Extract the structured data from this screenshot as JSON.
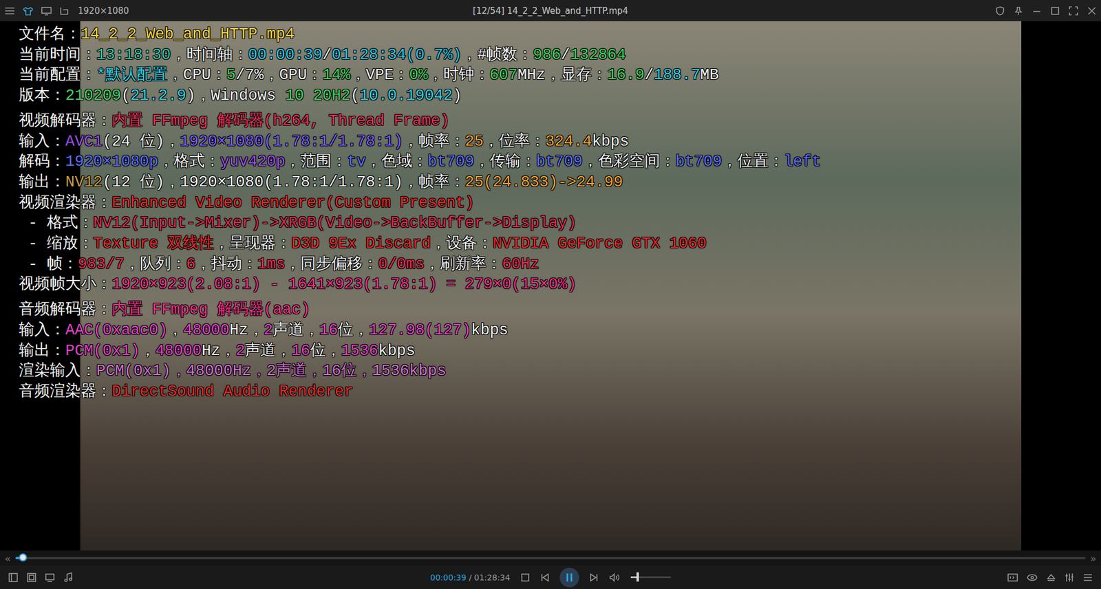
{
  "window": {
    "resolution": "1920×1080",
    "title": "[12/54] 14_2_2_Web_and_HTTP.mp4"
  },
  "osd": {
    "groups": [
      {
        "lines": [
          {
            "segments": [
              {
                "text": "文件名：",
                "color": "#f2f2f2"
              },
              {
                "text": "14_2_2_Web_and_HTTP.mp4",
                "color": "#f2d43a"
              }
            ]
          },
          {
            "segments": [
              {
                "text": "当前时间：",
                "color": "#f2f2f2"
              },
              {
                "text": "13:18:30",
                "color": "#38c0a8"
              },
              {
                "text": "，时间轴：",
                "color": "#f2f2f2"
              },
              {
                "text": "00:00:39",
                "color": "#2cc4e6"
              },
              {
                "text": "/",
                "color": "#f2f2f2"
              },
              {
                "text": "01:28:34",
                "color": "#2cc4e6"
              },
              {
                "text": "(0.7%)",
                "color": "#2cc4e6"
              },
              {
                "text": "，#帧数：",
                "color": "#f2f2f2"
              },
              {
                "text": "986",
                "color": "#3ed35a"
              },
              {
                "text": "/",
                "color": "#f2f2f2"
              },
              {
                "text": "132864",
                "color": "#3ed35a"
              }
            ]
          },
          {
            "segments": [
              {
                "text": "当前配置：",
                "color": "#f2f2f2"
              },
              {
                "text": "*默认配置",
                "color": "#2ed0e6"
              },
              {
                "text": "，CPU：",
                "color": "#f2f2f2"
              },
              {
                "text": "5",
                "color": "#3ed35a"
              },
              {
                "text": "/7%",
                "color": "#f2f2f2"
              },
              {
                "text": "，GPU：",
                "color": "#f2f2f2"
              },
              {
                "text": "14%",
                "color": "#3ed35a"
              },
              {
                "text": "，VPE：",
                "color": "#f2f2f2"
              },
              {
                "text": "0%",
                "color": "#3ed35a"
              },
              {
                "text": "，时钟：",
                "color": "#f2f2f2"
              },
              {
                "text": "607",
                "color": "#3ed35a"
              },
              {
                "text": "MHz，显存：",
                "color": "#f2f2f2"
              },
              {
                "text": "16.9",
                "color": "#3ed35a"
              },
              {
                "text": "/",
                "color": "#f2f2f2"
              },
              {
                "text": "188.7",
                "color": "#2ed0e6"
              },
              {
                "text": "MB",
                "color": "#f2f2f2"
              }
            ]
          },
          {
            "segments": [
              {
                "text": "版本：",
                "color": "#f2f2f2"
              },
              {
                "text": "210209",
                "color": "#3ed35a"
              },
              {
                "text": "(",
                "color": "#f2f2f2"
              },
              {
                "text": "21.2.9",
                "color": "#2ed0e6"
              },
              {
                "text": ")，Windows ",
                "color": "#f2f2f2"
              },
              {
                "text": "10 20H2",
                "color": "#3ed35a"
              },
              {
                "text": "(",
                "color": "#f2f2f2"
              },
              {
                "text": "10.0.19042",
                "color": "#2ed0e6"
              },
              {
                "text": ")",
                "color": "#f2f2f2"
              }
            ]
          }
        ]
      },
      {
        "lines": [
          {
            "segments": [
              {
                "text": "视频解码器：",
                "color": "#f2f2f2"
              },
              {
                "text": "内置 FFmpeg 解码器(h264, Thread Frame)",
                "color": "#e8305a"
              }
            ]
          },
          {
            "segments": [
              {
                "text": "输入：",
                "color": "#f2f2f2"
              },
              {
                "text": "AVC1",
                "color": "#9a4de6"
              },
              {
                "text": "(24 位)，",
                "color": "#f2f2f2"
              },
              {
                "text": "1920×1080(1.78:1/1.78:1)",
                "color": "#7a5cff"
              },
              {
                "text": "，帧率：",
                "color": "#f2f2f2"
              },
              {
                "text": "25",
                "color": "#f0a030"
              },
              {
                "text": "，位率：",
                "color": "#f2f2f2"
              },
              {
                "text": "324.4",
                "color": "#f0a030"
              },
              {
                "text": "kbps",
                "color": "#f2f2f2"
              }
            ]
          },
          {
            "segments": [
              {
                "text": "解码：",
                "color": "#f2f2f2"
              },
              {
                "text": "1920×1080p",
                "color": "#5a6cff"
              },
              {
                "text": "，格式：",
                "color": "#f2f2f2"
              },
              {
                "text": "yuv420p",
                "color": "#9a4de6"
              },
              {
                "text": "，范围：",
                "color": "#f2f2f2"
              },
              {
                "text": "tv",
                "color": "#5a6cff"
              },
              {
                "text": "，色域：",
                "color": "#f2f2f2"
              },
              {
                "text": "bt709",
                "color": "#5a6cff"
              },
              {
                "text": "，传输：",
                "color": "#f2f2f2"
              },
              {
                "text": "bt709",
                "color": "#5a6cff"
              },
              {
                "text": "，色彩空间：",
                "color": "#f2f2f2"
              },
              {
                "text": "bt709",
                "color": "#5a6cff"
              },
              {
                "text": "，位置：",
                "color": "#f2f2f2"
              },
              {
                "text": "left",
                "color": "#5a6cff"
              }
            ]
          },
          {
            "segments": [
              {
                "text": "输出：",
                "color": "#f2f2f2"
              },
              {
                "text": "NV12",
                "color": "#c89a3a"
              },
              {
                "text": "(12 位)，1920×1080(1.78:1/1.78:1)，帧率：",
                "color": "#f2f2f2"
              },
              {
                "text": "25(24.833)->24.99",
                "color": "#f0a030"
              }
            ]
          },
          {
            "segments": [
              {
                "text": "视频渲染器：",
                "color": "#f2f2f2"
              },
              {
                "text": "Enhanced Video Renderer(Custom Present)",
                "color": "#e82828"
              }
            ]
          },
          {
            "segments": [
              {
                "text": " - 格式：",
                "color": "#f2f2f2"
              },
              {
                "text": "NV12(Input->Mixer)->XRGB(Video->BackBuffer->Display)",
                "color": "#e02850"
              }
            ]
          },
          {
            "segments": [
              {
                "text": " - 缩放：",
                "color": "#f2f2f2"
              },
              {
                "text": "Texture 双线性",
                "color": "#e82828"
              },
              {
                "text": "，呈现器：",
                "color": "#f2f2f2"
              },
              {
                "text": "D3D 9Ex Discard",
                "color": "#e82828"
              },
              {
                "text": "，设备：",
                "color": "#f2f2f2"
              },
              {
                "text": "NVIDIA GeForce GTX 1060",
                "color": "#e82828"
              }
            ]
          },
          {
            "segments": [
              {
                "text": " - 帧：",
                "color": "#f2f2f2"
              },
              {
                "text": "983/7",
                "color": "#e82850"
              },
              {
                "text": "，队列：",
                "color": "#f2f2f2"
              },
              {
                "text": "6",
                "color": "#e82850"
              },
              {
                "text": "，抖动：",
                "color": "#f2f2f2"
              },
              {
                "text": "1ms",
                "color": "#e82850"
              },
              {
                "text": "，同步偏移：",
                "color": "#f2f2f2"
              },
              {
                "text": "0/0ms",
                "color": "#e82850"
              },
              {
                "text": "，刷新率：",
                "color": "#f2f2f2"
              },
              {
                "text": "60Hz",
                "color": "#e82850"
              }
            ]
          },
          {
            "segments": [
              {
                "text": "视频帧大小：",
                "color": "#f2f2f2"
              },
              {
                "text": "1920×923(2.08:1) - 1641×923(1.78:1) = 279×0(15×0%)",
                "color": "#f0308a"
              }
            ]
          }
        ]
      },
      {
        "lines": [
          {
            "segments": [
              {
                "text": "音频解码器：",
                "color": "#f2f2f2"
              },
              {
                "text": "内置 FFmpeg 解码器(aac)",
                "color": "#f0308a"
              }
            ]
          },
          {
            "segments": [
              {
                "text": "输入：",
                "color": "#f2f2f2"
              },
              {
                "text": "AAC(0xaac0)",
                "color": "#e040c8"
              },
              {
                "text": "，",
                "color": "#f2f2f2"
              },
              {
                "text": "48000",
                "color": "#e040c8"
              },
              {
                "text": "Hz，",
                "color": "#f2f2f2"
              },
              {
                "text": "2",
                "color": "#e040c8"
              },
              {
                "text": "声道，",
                "color": "#f2f2f2"
              },
              {
                "text": "16",
                "color": "#e040c8"
              },
              {
                "text": "位，",
                "color": "#f2f2f2"
              },
              {
                "text": "127.98(127)",
                "color": "#e040c8"
              },
              {
                "text": "kbps",
                "color": "#f2f2f2"
              }
            ]
          },
          {
            "segments": [
              {
                "text": "输出：",
                "color": "#f2f2f2"
              },
              {
                "text": "PCM(0x1)",
                "color": "#e040c8"
              },
              {
                "text": "，",
                "color": "#f2f2f2"
              },
              {
                "text": "48000",
                "color": "#e040c8"
              },
              {
                "text": "Hz，",
                "color": "#f2f2f2"
              },
              {
                "text": "2",
                "color": "#e040c8"
              },
              {
                "text": "声道，",
                "color": "#f2f2f2"
              },
              {
                "text": "16",
                "color": "#e040c8"
              },
              {
                "text": "位，",
                "color": "#f2f2f2"
              },
              {
                "text": "1536",
                "color": "#e040c8"
              },
              {
                "text": "kbps",
                "color": "#f2f2f2"
              }
            ]
          },
          {
            "segments": [
              {
                "text": "渲染输入：",
                "color": "#f2f2f2"
              },
              {
                "text": "PCM(0x1)，48000Hz，2声道，16位，1536kbps",
                "color": "#d070d0"
              }
            ]
          },
          {
            "segments": [
              {
                "text": "音频渲染器：",
                "color": "#f2f2f2"
              },
              {
                "text": "DirectSound Audio Renderer",
                "color": "#e82828"
              }
            ]
          }
        ]
      }
    ]
  },
  "seek": {
    "left": "«",
    "right": "»",
    "level": 0.007
  },
  "controls": {
    "current": "00:00:39",
    "total": " / 01:28:34",
    "playing": true,
    "volume": 0.18
  }
}
